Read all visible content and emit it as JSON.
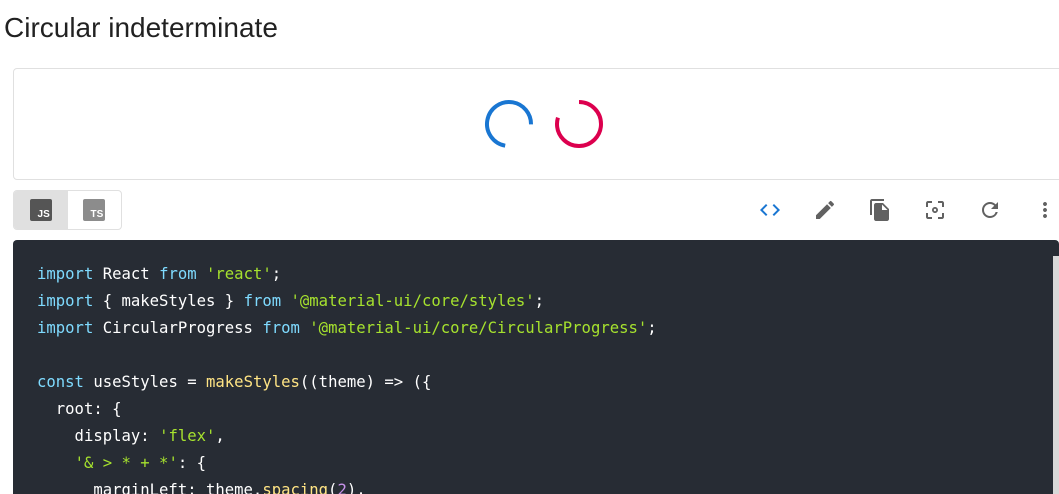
{
  "page": {
    "title": "Circular indeterminate"
  },
  "demo": {
    "spinners": [
      {
        "name": "primary",
        "color": "#1976d2"
      },
      {
        "name": "secondary",
        "color": "#dc004e"
      }
    ]
  },
  "toolbar": {
    "languages": [
      {
        "label": "JS",
        "selected": true,
        "badge_color": "#555555"
      },
      {
        "label": "TS",
        "selected": false,
        "badge_color": "#8c8c8c"
      }
    ],
    "actions": [
      {
        "icon": "code-icon",
        "color": "#1976d2"
      },
      {
        "icon": "edit-icon",
        "color": "#616161"
      },
      {
        "icon": "copy-icon",
        "color": "#616161"
      },
      {
        "icon": "reset-focus-icon",
        "color": "#616161"
      },
      {
        "icon": "refresh-icon",
        "color": "#616161"
      },
      {
        "icon": "more-vert-icon",
        "color": "#616161"
      }
    ]
  },
  "code": {
    "lines": [
      [
        [
          "kw",
          "import"
        ],
        [
          "p",
          " React "
        ],
        [
          "kw",
          "from"
        ],
        [
          "p",
          " "
        ],
        [
          "str",
          "'react'"
        ],
        [
          "p",
          ";"
        ]
      ],
      [
        [
          "kw",
          "import"
        ],
        [
          "p",
          " { makeStyles } "
        ],
        [
          "kw",
          "from"
        ],
        [
          "p",
          " "
        ],
        [
          "str",
          "'@material-ui/core/styles'"
        ],
        [
          "p",
          ";"
        ]
      ],
      [
        [
          "kw",
          "import"
        ],
        [
          "p",
          " CircularProgress "
        ],
        [
          "kw",
          "from"
        ],
        [
          "p",
          " "
        ],
        [
          "str",
          "'@material-ui/core/CircularProgress'"
        ],
        [
          "p",
          ";"
        ]
      ],
      [],
      [
        [
          "kw",
          "const"
        ],
        [
          "p",
          " useStyles = "
        ],
        [
          "fn",
          "makeStyles"
        ],
        [
          "p",
          "((theme) => ({"
        ]
      ],
      [
        [
          "p",
          "  root: {"
        ]
      ],
      [
        [
          "p",
          "    display: "
        ],
        [
          "str",
          "'flex'"
        ],
        [
          "p",
          ","
        ]
      ],
      [
        [
          "p",
          "    "
        ],
        [
          "str",
          "'& > * + *'"
        ],
        [
          "p",
          ": {"
        ]
      ],
      [
        [
          "p",
          "      marginLeft: theme."
        ],
        [
          "fn",
          "spacing"
        ],
        [
          "p",
          "("
        ],
        [
          "num",
          "2"
        ],
        [
          "p",
          "),"
        ]
      ]
    ]
  }
}
